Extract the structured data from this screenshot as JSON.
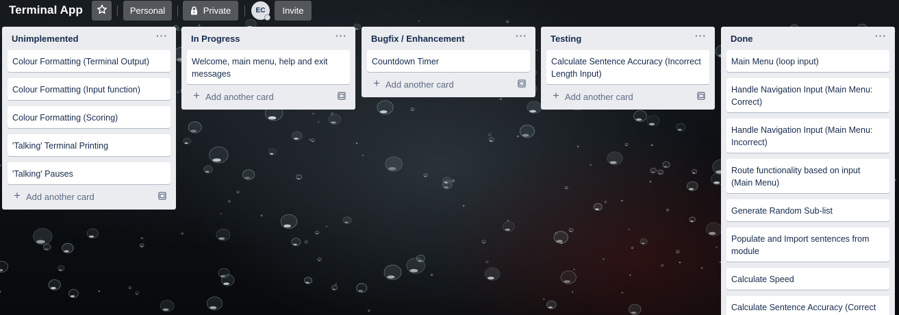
{
  "board": {
    "title": "Terminal App",
    "visibility_team": "Personal",
    "privacy": "Private",
    "member_initials": "EC",
    "invite_label": "Invite",
    "icons": {
      "star": "star-icon",
      "lock": "lock-icon",
      "more": "more-icon",
      "add": "plus-icon",
      "template": "card-template-icon"
    }
  },
  "lists": [
    {
      "title": "Unimplemented",
      "menu": "···",
      "cards": [
        "Colour Formatting (Terminal Output)",
        "Colour Formatting (Input function)",
        "Colour Formatting (Scoring)",
        "'Talking' Terminal Printing",
        "'Talking' Pauses"
      ],
      "add_label": "Add another card"
    },
    {
      "title": "In Progress",
      "menu": "···",
      "cards": [
        "Welcome, main menu, help and exit messages"
      ],
      "add_label": "Add another card"
    },
    {
      "title": "Bugfix / Enhancement",
      "menu": "···",
      "cards": [
        "Countdown Timer"
      ],
      "add_label": "Add another card"
    },
    {
      "title": "Testing",
      "menu": "···",
      "cards": [
        "Calculate Sentence Accuracy (Incorrect Length Input)"
      ],
      "add_label": "Add another card"
    },
    {
      "title": "Done",
      "menu": "···",
      "cards": [
        "Main Menu (loop input)",
        "Handle Navigation Input (Main Menu: Correct)",
        "Handle Navigation Input (Main Menu: Incorrect)",
        "Route functionality based on input (Main Menu)",
        "Generate Random Sub-list",
        "Populate and Import sentences from module",
        "Calculate Speed",
        "Calculate Sentence Accuracy (Correct Length Input)"
      ],
      "add_label": ""
    }
  ]
}
